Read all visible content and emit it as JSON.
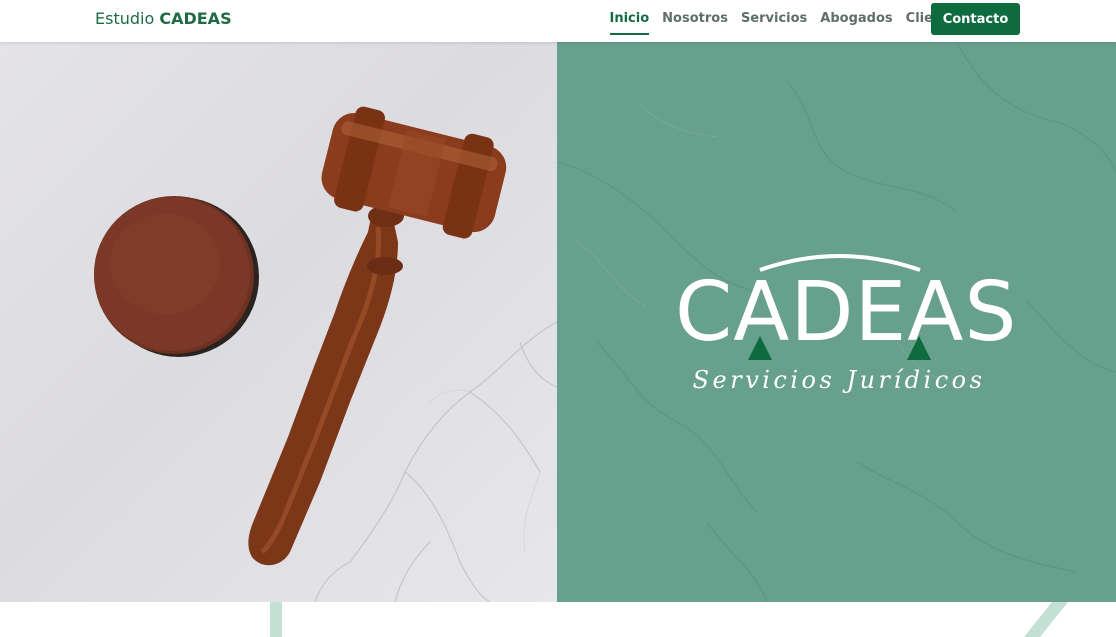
{
  "brand": {
    "prefix": "Estudio ",
    "name": "CADEAS"
  },
  "nav": {
    "items": [
      {
        "label": "Inicio",
        "active": true
      },
      {
        "label": "Nosotros",
        "active": false
      },
      {
        "label": "Servicios",
        "active": false
      },
      {
        "label": "Abogados",
        "active": false
      },
      {
        "label": "Clientes",
        "active": false
      }
    ],
    "contact_label": "Contacto"
  },
  "hero": {
    "image": "gavel-on-marble",
    "logo_word": "CADEAS",
    "logo_subtitle": "Servicios Jurídicos"
  },
  "colors": {
    "brand_green": "#0e6b3e",
    "panel_green": "#67a08c",
    "accent_light_green": "#c4dfd4",
    "wood": "#8a3f22"
  }
}
